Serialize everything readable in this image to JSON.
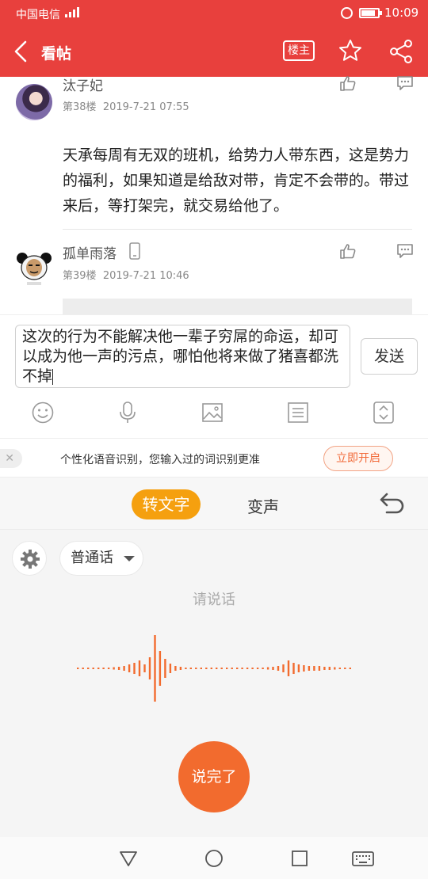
{
  "status_bar": {
    "carrier": "中国电信",
    "network": "4G",
    "time": "10:09",
    "battery_level": 0.85
  },
  "header": {
    "title": "看帖",
    "op_label": "楼主"
  },
  "posts": [
    {
      "author": "汰子妃",
      "floor": "第38楼",
      "date": "2019-7-21 07:55",
      "body": "天承每周有无双的班机，给势力人带东西，这是势力的福利，如果知道是给敌对带，肯定不会带的。带过来后，等打架完，就交易给他了。"
    },
    {
      "author": "孤单雨落",
      "floor": "第39楼",
      "date": "2019-7-21 10:46",
      "body": ""
    }
  ],
  "reply": {
    "value": "这次的行为不能解决他一辈子穷屌的命运，却可以成为他一声的污点，哪怕他将来做了猪喜都洗不掉",
    "send_label": "发送"
  },
  "toolbar": {
    "icons": [
      "emoji-icon",
      "microphone-icon",
      "image-icon",
      "list-icon",
      "expand-icon"
    ]
  },
  "tip": {
    "text": "个性化语音识别，您输入过的词识别更准",
    "button_label": "立即开启"
  },
  "voice": {
    "tab_active_label": "转文字",
    "tab_label": "变声",
    "language": "普通话",
    "hint": "请说话",
    "finish_label": "说完了",
    "accent_color": "#f26b2e"
  },
  "colors": {
    "header": "#e8403d",
    "tab_active": "#f5a00f"
  }
}
